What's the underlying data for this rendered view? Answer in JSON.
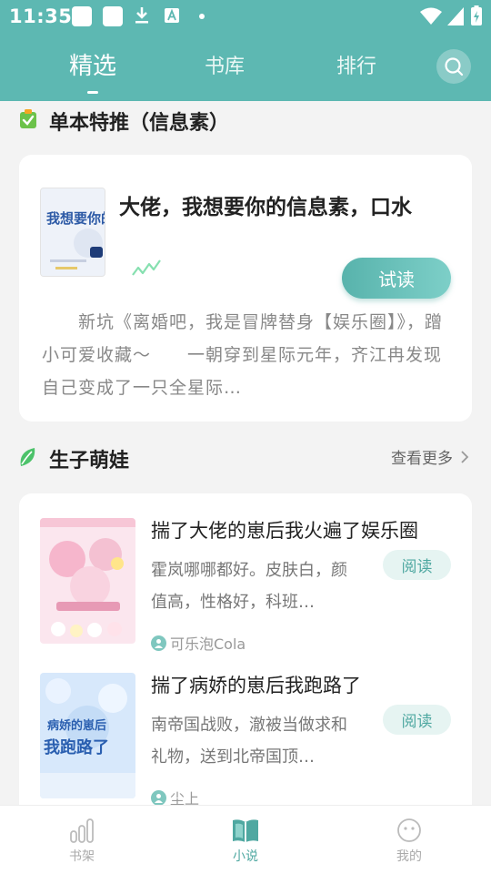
{
  "status_bar": {
    "time": "11:35"
  },
  "tabs": [
    {
      "label": "精选",
      "active": true
    },
    {
      "label": "书库",
      "active": false
    },
    {
      "label": "排行",
      "active": false
    }
  ],
  "featured": {
    "section_title": "单本特推（信息素）",
    "book": {
      "title": "大佬，我想要你的信息素，口水",
      "cover_text": "我想要你的信息素",
      "try_label": "试读",
      "description": "　　新坑《离婚吧，我是冒牌替身【娱乐圈】》，蹭小可爱收藏～　　一朝穿到星际元年，齐江冉发现自己变成了一只全星际…"
    }
  },
  "section2": {
    "title": "生子萌娃",
    "more_label": "查看更多",
    "books": [
      {
        "title": "揣了大佬的崽后我火遍了娱乐圈",
        "description": "霍岚哪哪都好。皮肤白，颜值高，性格好，科班…",
        "read_label": "阅读",
        "author": "可乐泡Cola"
      },
      {
        "title": "揣了病娇的崽后我跑路了",
        "description": "南帝国战败，澈被当做求和礼物，送到北帝国顶…",
        "read_label": "阅读",
        "author": "尘上",
        "cover_text": "揣了病娇的崽后我跑路了"
      }
    ]
  },
  "bottom_nav": [
    {
      "label": "书架",
      "icon": "bookshelf-icon",
      "active": false
    },
    {
      "label": "小说",
      "icon": "open-book-icon",
      "active": true
    },
    {
      "label": "我的",
      "icon": "profile-face-icon",
      "active": false
    }
  ],
  "colors": {
    "accent": "#5db8b2",
    "accent_dark": "#4fa8a1",
    "background": "#f3f3f3"
  }
}
